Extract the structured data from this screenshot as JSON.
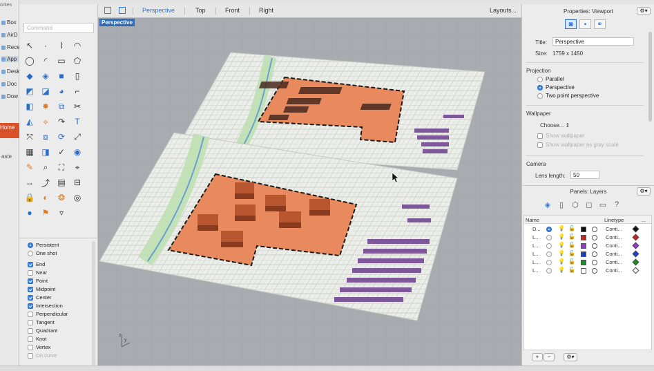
{
  "finder": {
    "favorites_label": "orites",
    "items": [
      {
        "label": "Box"
      },
      {
        "label": "AirD"
      },
      {
        "label": "Rece"
      },
      {
        "label": "App"
      },
      {
        "label": "Desk"
      },
      {
        "label": "Doc"
      },
      {
        "label": "Dow"
      }
    ],
    "home_label": "Home",
    "paste_label": "aste"
  },
  "command": {
    "placeholder": "Command"
  },
  "viewport_tabs": [
    "Perspective",
    "Top",
    "Front",
    "Right"
  ],
  "layouts_label": "Layouts...",
  "viewport": {
    "label": "Perspective",
    "axis_z": "z",
    "axis_y": "y"
  },
  "osnap": {
    "modes": [
      {
        "label": "Persistent",
        "selected": true
      },
      {
        "label": "One shot",
        "selected": false
      }
    ],
    "snaps": [
      {
        "label": "End",
        "checked": true
      },
      {
        "label": "Near",
        "checked": false
      },
      {
        "label": "Point",
        "checked": true
      },
      {
        "label": "Midpoint",
        "checked": true
      },
      {
        "label": "Center",
        "checked": true
      },
      {
        "label": "Intersection",
        "checked": true
      },
      {
        "label": "Perpendicular",
        "checked": false
      },
      {
        "label": "Tangent",
        "checked": false
      },
      {
        "label": "Quadrant",
        "checked": false
      },
      {
        "label": "Knot",
        "checked": false
      },
      {
        "label": "Vertex",
        "checked": false
      },
      {
        "label": "On curve",
        "checked": false,
        "dim": true
      }
    ]
  },
  "properties": {
    "header": "Properties: Viewport",
    "title_label": "Title:",
    "title_value": "Perspective",
    "size_label": "Size:",
    "size_value": "1759 x 1450",
    "projection_label": "Projection",
    "projection_options": [
      {
        "label": "Parallel",
        "selected": false
      },
      {
        "label": "Perspective",
        "selected": true
      },
      {
        "label": "Two point perspective",
        "selected": false
      }
    ],
    "wallpaper_label": "Wallpaper",
    "choose_label": "Choose...",
    "show_wallpaper": "Show wallpaper",
    "show_wallpaper_gray": "Show wallpaper as gray scale",
    "camera_label": "Camera",
    "lens_label": "Lens length:",
    "lens_value": "50"
  },
  "layers": {
    "header": "Panels: Layers",
    "col_name": "Name",
    "col_linetype": "Linetype",
    "col_more": "...",
    "rows": [
      {
        "name": "D...",
        "current": true,
        "color": "#111111",
        "linetype": "Conti..."
      },
      {
        "name": "L...",
        "current": false,
        "color": "#c0281c",
        "linetype": "Conti..."
      },
      {
        "name": "L...",
        "current": false,
        "color": "#8a3fc4",
        "linetype": "Conti..."
      },
      {
        "name": "L...",
        "current": false,
        "color": "#1f3fc8",
        "linetype": "Conti..."
      },
      {
        "name": "L...",
        "current": false,
        "color": "#1f8c2a",
        "linetype": "Conti..."
      },
      {
        "name": "L...",
        "current": false,
        "color": "#ffffff",
        "linetype": "Conti..."
      }
    ],
    "add_label": "+",
    "remove_label": "−"
  }
}
